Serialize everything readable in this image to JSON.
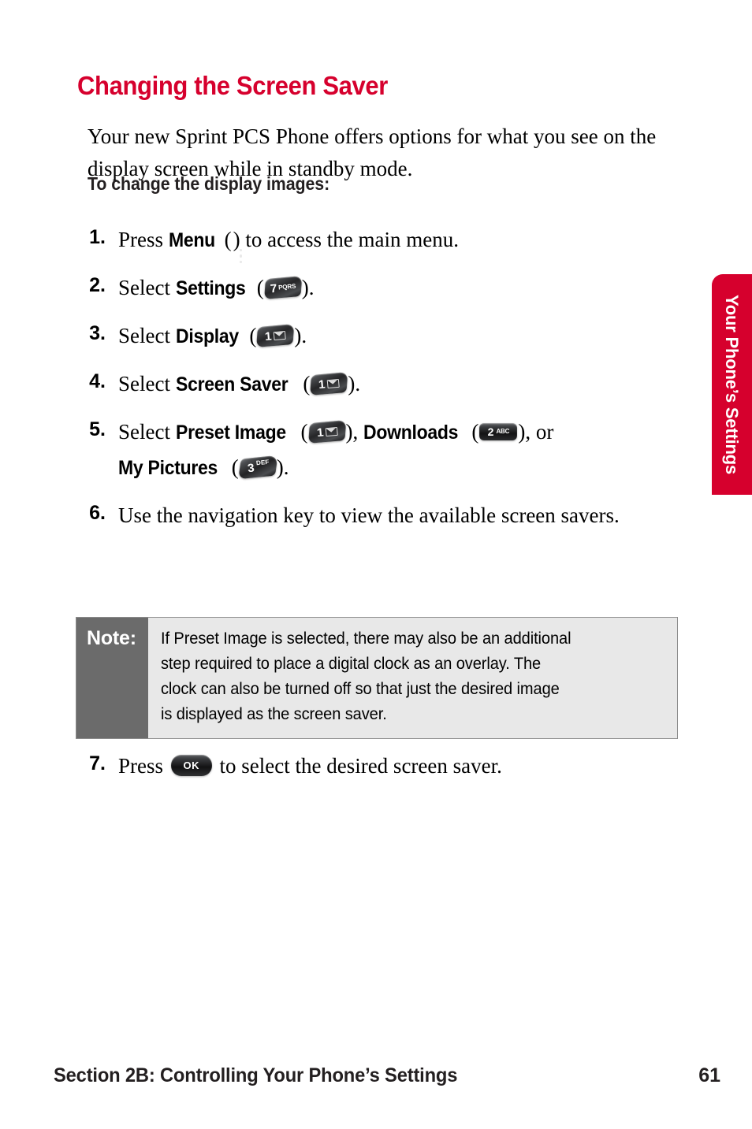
{
  "page": {
    "heading": "Changing the Screen Saver",
    "intro": "Your new Sprint PCS Phone offers options for what you see on the display screen while in standby mode.",
    "subheading": "To change the display images:",
    "accent_color": "#d6002d",
    "note_label_bg": "#6b6b6b",
    "note_body_bg": "#e8e8e8"
  },
  "side_tab": {
    "label": "Your Phone’s Settings"
  },
  "steps": [
    {
      "number": "1.",
      "pre": "Press ",
      "ui_label": "Menu",
      "mid": " (",
      "icon": "menu-key-icon",
      "post": ") to access the main menu.",
      "line2": ""
    },
    {
      "number": "2.",
      "pre": "Select ",
      "ui_label": "Settings",
      "mid": " (",
      "icon": "key-7-pqrs-icon",
      "post": ")."
    },
    {
      "number": "3.",
      "pre": "Select ",
      "ui_label": "Display",
      "mid": " (",
      "icon": "key-1-mail-icon",
      "post": ")."
    },
    {
      "number": "4.",
      "pre": "Select ",
      "ui_label": "Screen Saver",
      "mid": " (",
      "icon": "key-1-mail-icon",
      "post": ")."
    },
    {
      "number": "5.",
      "pre": "Select ",
      "ui_label": "Preset Image",
      "mid": " (",
      "icon": "key-1-mail-icon",
      "post": "), ",
      "ui_label2": "Downloads",
      "mid2": " (",
      "icon2": "key-2-abc-icon",
      "post2": "), or",
      "ui_label3": "My Pictures",
      "mid3": " (",
      "icon3": "key-3-def-icon",
      "post3": ")."
    },
    {
      "number": "6.",
      "text": "Use the navigation key to view the available screen savers."
    }
  ],
  "note": {
    "label": "Note:",
    "lines": [
      "If Preset Image is selected, there may also be an additional",
      "step required to place a digital clock as an overlay. The",
      "clock can also be turned off so that just the desired image",
      "is displayed as the screen saver."
    ]
  },
  "step_after_note": {
    "number": "7.",
    "pre": "Press ",
    "icon": "ok-key-icon",
    "post": " to select the desired screen saver.",
    "icon_label": "OK"
  },
  "keys": {
    "k1": {
      "digit": "1",
      "sub": "envelope"
    },
    "k2": {
      "digit": "2",
      "sub": "ABC"
    },
    "k3": {
      "digit": "3",
      "sub": "DEF"
    },
    "k7": {
      "digit": "7",
      "sub": "PQRS"
    }
  },
  "footer": {
    "section": "Section 2B: Controlling Your Phone’s Settings",
    "page_number": "61"
  }
}
